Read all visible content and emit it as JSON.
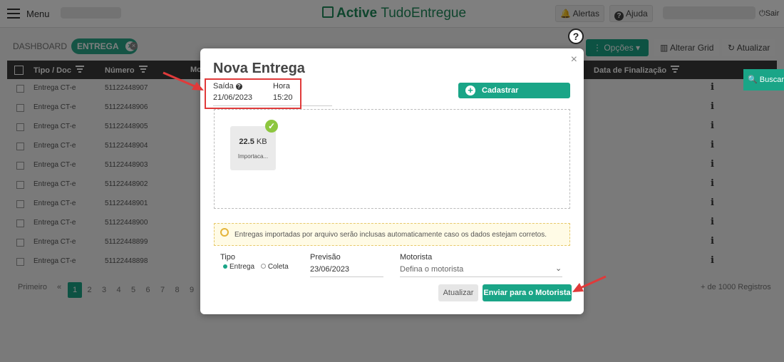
{
  "topbar": {
    "menu_label": "Menu",
    "logo_brand": "Active",
    "logo_product": "TudoEntregue",
    "alerts_label": "Alertas",
    "help_label": "Ajuda",
    "logout_label": "Sair"
  },
  "toolbar": {
    "dashboard_crumb": "DASHBOARD",
    "active_tag": "ENTREGA",
    "options_label": "Opções",
    "alter_grid_label": "Alterar Grid",
    "refresh_label": "Atualizar",
    "search_label": "Buscar"
  },
  "table": {
    "headers": {
      "type_doc": "Tipo / Doc",
      "number": "Número",
      "driver": "Motorista",
      "end_date": "Data de Finalização"
    },
    "rows": [
      {
        "type": "Entrega CT-e",
        "number": "51122448907"
      },
      {
        "type": "Entrega CT-e",
        "number": "51122448906"
      },
      {
        "type": "Entrega CT-e",
        "number": "51122448905"
      },
      {
        "type": "Entrega CT-e",
        "number": "51122448904"
      },
      {
        "type": "Entrega CT-e",
        "number": "51122448903"
      },
      {
        "type": "Entrega CT-e",
        "number": "51122448902"
      },
      {
        "type": "Entrega CT-e",
        "number": "51122448901"
      },
      {
        "type": "Entrega CT-e",
        "number": "51122448900"
      },
      {
        "type": "Entrega CT-e",
        "number": "51122448899"
      },
      {
        "type": "Entrega CT-e",
        "number": "51122448898"
      }
    ],
    "info_glyph": "i"
  },
  "pager": {
    "first": "Primeiro",
    "prev": "«",
    "pages": [
      "1",
      "2",
      "3",
      "4",
      "5",
      "6",
      "7",
      "8",
      "9"
    ],
    "active_page": "1",
    "total": "+ de 1000 Registros"
  },
  "modal": {
    "title": "Nova Entrega",
    "close": "×",
    "departure_label": "Saída",
    "departure_value": "21/06/2023",
    "time_label": "Hora",
    "time_value": "15:20",
    "manual_button": "Cadastrar Manualmente",
    "file": {
      "size_number": "22.5",
      "size_unit": "KB",
      "name": "Importaca..."
    },
    "notice": "Entregas importadas por arquivo serão inclusas automaticamente caso os dados estejam corretos.",
    "type_label": "Tipo",
    "type_options": [
      "Entrega",
      "Coleta"
    ],
    "forecast_label": "Previsão",
    "forecast_value": "23/06/2023",
    "driver_label": "Motorista",
    "driver_placeholder": "Defina o motorista",
    "update_button": "Atualizar",
    "send_button": "Enviar para o Motorista"
  },
  "help_glyph": "?",
  "colors": {
    "accent": "#1aa587",
    "annotation_red": "#e03a3a",
    "notice_bg": "#fffbe6"
  }
}
